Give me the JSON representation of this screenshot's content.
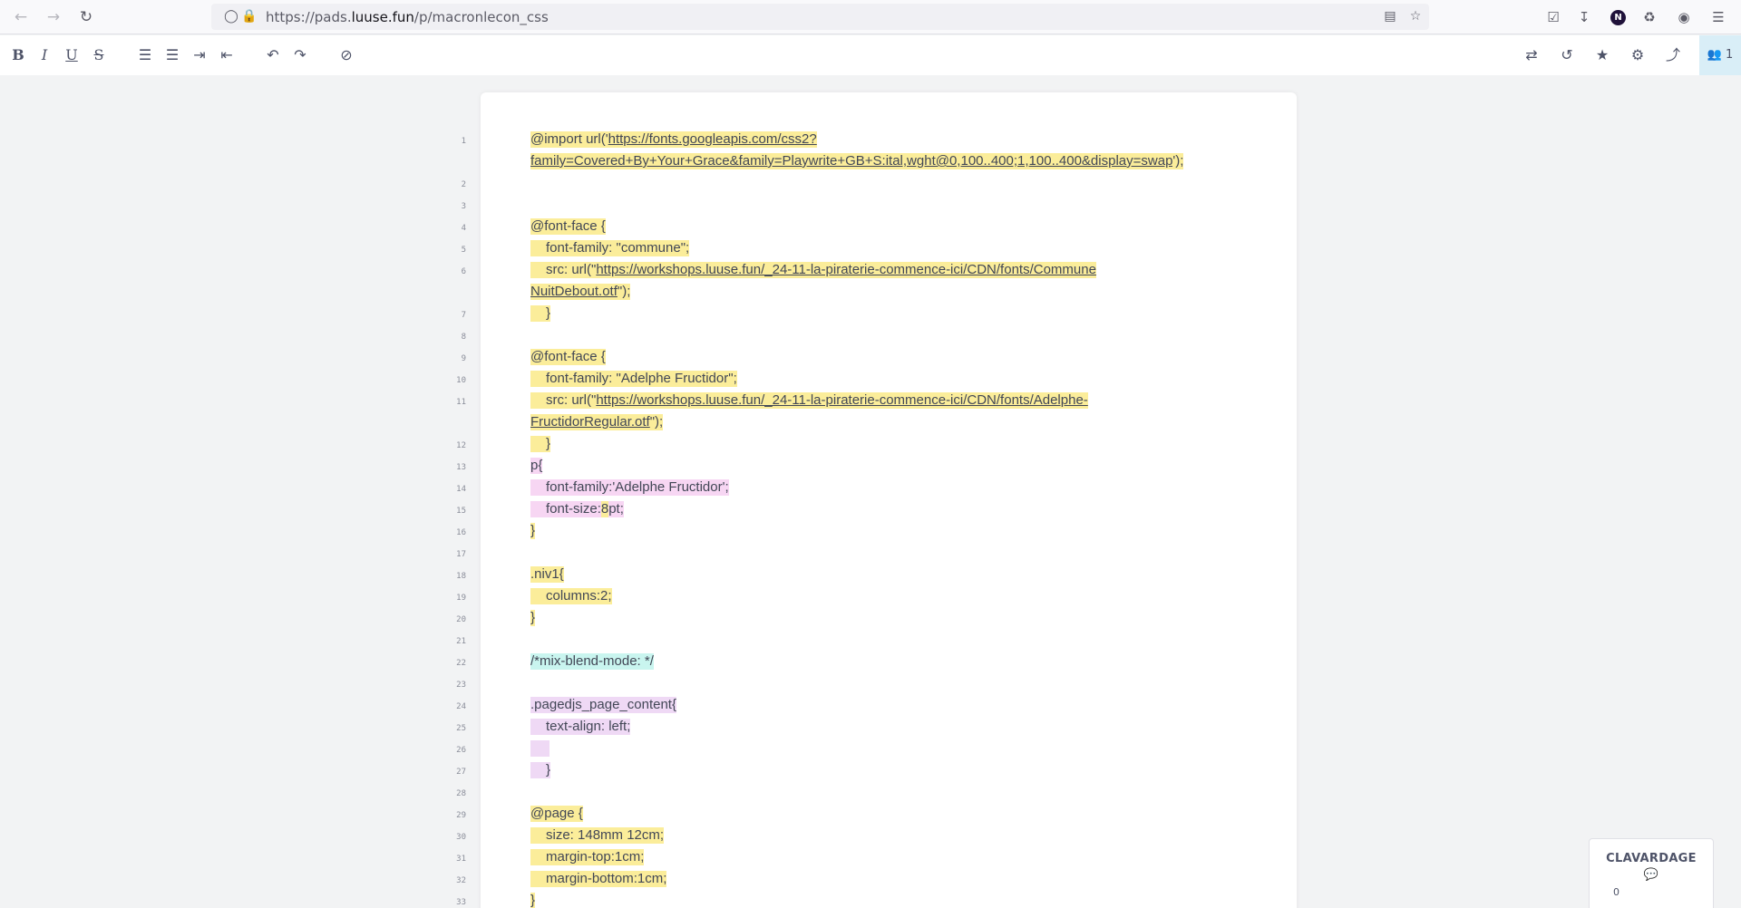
{
  "browser": {
    "url_prefix": "https://pads.",
    "url_domain": "luuse.fun",
    "url_path": "/p/macronlecon_css",
    "back_icon": "arrow-left-icon",
    "forward_icon": "arrow-right-icon",
    "reload_icon": "reload-icon",
    "profile_initial": "N"
  },
  "toolbar": {
    "bold": "B",
    "italic": "I",
    "underline": "U",
    "strike": "S"
  },
  "users": {
    "count": "1"
  },
  "lines": [
    {
      "n": "1"
    },
    {
      "n": "2"
    },
    {
      "n": "3"
    },
    {
      "n": "4"
    },
    {
      "n": "5"
    },
    {
      "n": "6"
    },
    {
      "n": "7"
    },
    {
      "n": "8"
    },
    {
      "n": "9"
    },
    {
      "n": "10"
    },
    {
      "n": "11"
    },
    {
      "n": "12"
    },
    {
      "n": "13"
    },
    {
      "n": "14"
    },
    {
      "n": "15"
    },
    {
      "n": "16"
    },
    {
      "n": "17"
    },
    {
      "n": "18"
    },
    {
      "n": "19"
    },
    {
      "n": "20"
    },
    {
      "n": "21"
    },
    {
      "n": "22"
    },
    {
      "n": "23"
    },
    {
      "n": "24"
    },
    {
      "n": "25"
    },
    {
      "n": "26"
    },
    {
      "n": "27"
    },
    {
      "n": "28"
    },
    {
      "n": "29"
    },
    {
      "n": "30"
    },
    {
      "n": "31"
    },
    {
      "n": "32"
    },
    {
      "n": "33"
    }
  ],
  "code": {
    "l1a": "@import url('",
    "l1_link_a": "https://fonts.googleapis.com/css2?",
    "l1_link_b": "family=Covered+By+Your+Grace&family=Playwrite+GB+S:ital,wght@0,100..400;1,100..400&display=swap",
    "l1b": "');",
    "l4": "@font-face {",
    "l5": "font-family: \"commune\";",
    "l6a": "src: url(\"",
    "l6_link_a": "https://workshops.luuse.fun/_24-11-la-piraterie-commence-ici/CDN/fonts/Commune",
    "l6_link_b": "NuitDebout.otf",
    "l6b": "\");",
    "l7": "}",
    "l9": "@font-face {",
    "l10": "font-family: \"Adelphe Fructidor\";",
    "l11a": "src: url(\"",
    "l11_link_a": "https://workshops.luuse.fun/_24-11-la-piraterie-commence-ici/CDN/fonts/Adelphe-",
    "l11_link_b": "FructidorRegular.otf",
    "l11b": "\");",
    "l12": "}",
    "l13": "p{",
    "l14": "font-family:'Adelphe Fructidor';",
    "l15a": "font-size:",
    "l15b": "8",
    "l15c": "pt;",
    "l16": "}",
    "l18": ".niv1{",
    "l19a": "columns:",
    "l19b": "2",
    "l19c": ";",
    "l20": "}",
    "l22": "/*mix-blend-mode: */",
    "l24": ".pagedjs_page_content{",
    "l25": "text-align: left;",
    "l27": "}",
    "l29": "@page {",
    "l30a": "size: 148mm ",
    "l30b": "1",
    "l30c": "2cm;",
    "l31": "margin-top:1cm;",
    "l32": "margin-bottom:1cm;",
    "l33": "}"
  },
  "chat": {
    "title": "CLAVARDAGE",
    "count": "0"
  },
  "colors": {
    "author_yellow": "#fbed9a",
    "author_pink": "#f7d6f3",
    "author_cyan": "#c9f5ef",
    "author_lilac": "#efd9f5"
  }
}
